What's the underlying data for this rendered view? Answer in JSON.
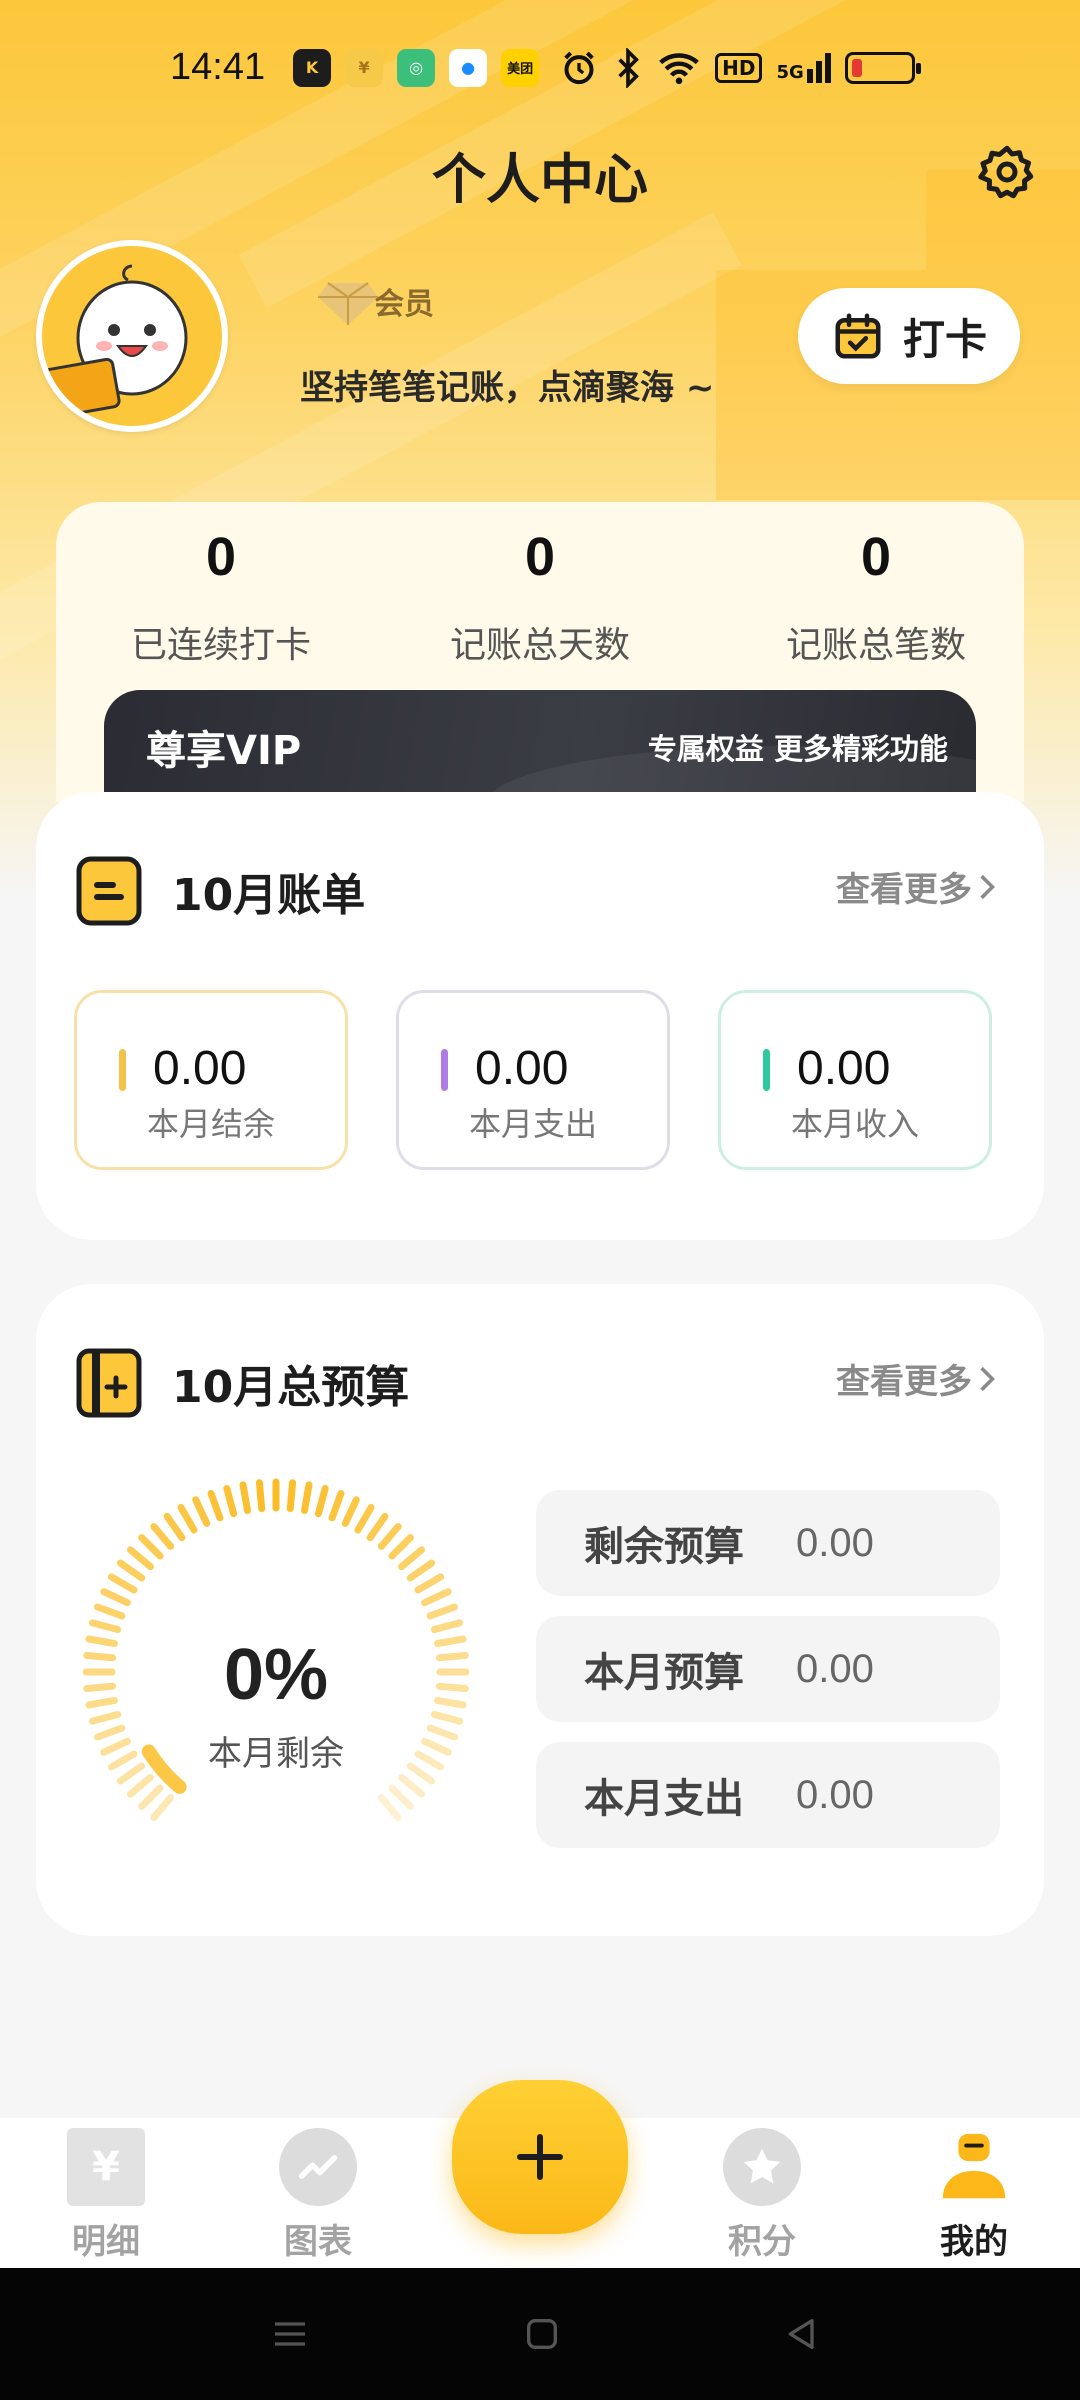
{
  "status_bar": {
    "time": "14:41",
    "apps": [
      {
        "icon": "kuai-app-icon",
        "glyph": "K",
        "bg": "#1d1d1d",
        "fg": "#fcc73a"
      },
      {
        "icon": "yuan-app-icon",
        "glyph": "¥",
        "bg": "#f7c948",
        "fg": "#a5731c"
      },
      {
        "icon": "fingerprint-app-icon",
        "glyph": "◎",
        "bg": "#3bbf7a",
        "fg": "#ffffff"
      },
      {
        "icon": "blue-circle-app-icon",
        "glyph": "●",
        "bg": "#ffffff",
        "fg": "#1a8cff"
      },
      {
        "icon": "meituan-app-icon",
        "glyph": "美团",
        "bg": "#ffd100",
        "fg": "#111111"
      }
    ],
    "network": "HD",
    "signal": "5G"
  },
  "header": {
    "title": "个人中心"
  },
  "profile": {
    "member_label": "会员",
    "motto": "坚持笔笔记账，点滴聚海 ~",
    "checkin_label": "打卡"
  },
  "stats": [
    {
      "value": "0",
      "label": "已连续打卡"
    },
    {
      "value": "0",
      "label": "记账总天数"
    },
    {
      "value": "0",
      "label": "记账总笔数"
    }
  ],
  "vip": {
    "title": "尊享VIP",
    "subtitle": "专属权益 更多精彩功能"
  },
  "bill": {
    "title": "10月账单",
    "more": "查看更多",
    "items": [
      {
        "value": "0.00",
        "label": "本月结余",
        "color": "#f3c24a",
        "border": "#f8e1a8"
      },
      {
        "value": "0.00",
        "label": "本月支出",
        "color": "#b07ae6",
        "border": "#e0dde8"
      },
      {
        "value": "0.00",
        "label": "本月收入",
        "color": "#2ec9a0",
        "border": "#cdeee5"
      }
    ]
  },
  "budget": {
    "title": "10月总预算",
    "more": "查看更多",
    "percent": "0%",
    "percent_label": "本月剩余",
    "remaining_fraction": 0,
    "rows": [
      {
        "label": "剩余预算",
        "value": "0.00"
      },
      {
        "label": "本月预算",
        "value": "0.00"
      },
      {
        "label": "本月支出",
        "value": "0.00"
      }
    ]
  },
  "nav": [
    {
      "label": "明细",
      "icon": "ledger-icon"
    },
    {
      "label": "图表",
      "icon": "chart-icon"
    },
    {
      "label": "积分",
      "icon": "star-icon"
    },
    {
      "label": "我的",
      "icon": "profile-icon",
      "active": true
    }
  ],
  "colors": {
    "accent": "#fbb818",
    "accent_light": "#fcc73a",
    "vip_bg": "#2b2c33"
  }
}
